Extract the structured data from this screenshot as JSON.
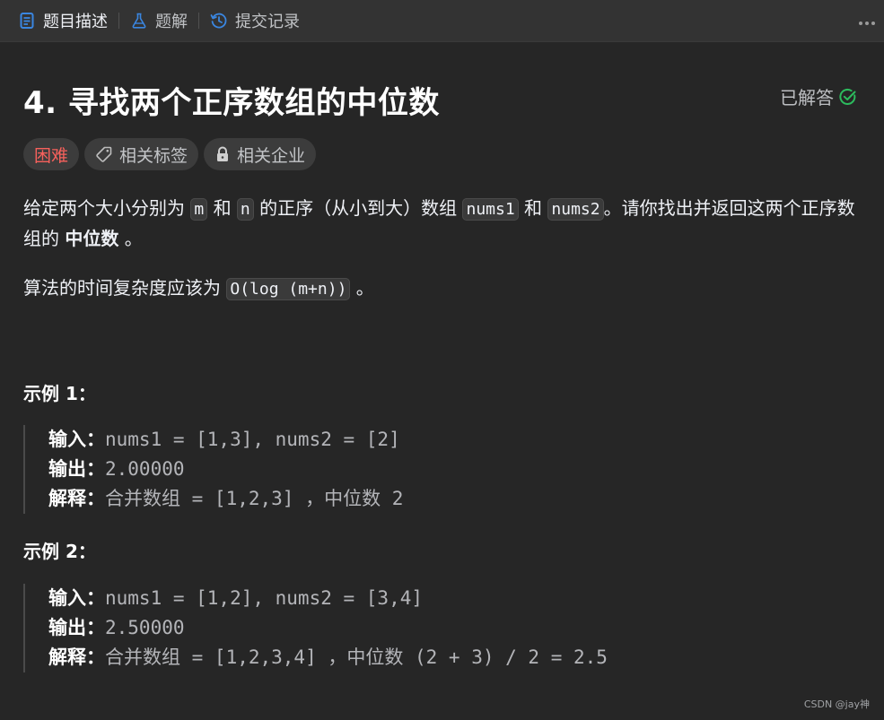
{
  "tabs": [
    {
      "label": "题目描述",
      "icon": "description-icon",
      "active": true
    },
    {
      "label": "题解",
      "icon": "flask-icon",
      "active": false
    },
    {
      "label": "提交记录",
      "icon": "history-icon",
      "active": false
    }
  ],
  "more_icon": "more-dots-icon",
  "problem": {
    "title": "4. 寻找两个正序数组的中位数",
    "status": "已解答",
    "tags": {
      "difficulty": "困难",
      "related_tags": "相关标签",
      "related_companies": "相关企业"
    },
    "description": {
      "p1_a": "给定两个大小分别为",
      "m": "m",
      "he1": "和",
      "n": "n",
      "p1_b": "的正序（从小到大）数组",
      "nums1": "nums1",
      "he2": "和",
      "nums2": "nums2",
      "p1_c": "。请你找出并返回这两个正序数组的",
      "median": "中位数",
      "p1_d": "。",
      "p2_a": "算法的时间复杂度应该为",
      "complexity": "O(log (m+n))",
      "p2_b": "。"
    },
    "examples": [
      {
        "title": "示例 1：",
        "input_label": "输入：",
        "input": "nums1 = [1,3], nums2 = [2]",
        "output_label": "输出：",
        "output": "2.00000",
        "explain_label": "解释：",
        "explain": "合并数组 = [1,2,3] ，中位数 2"
      },
      {
        "title": "示例 2：",
        "input_label": "输入：",
        "input": "nums1 = [1,2], nums2 = [3,4]",
        "output_label": "输出：",
        "output": "2.50000",
        "explain_label": "解释：",
        "explain": "合并数组 = [1,2,3,4] ，中位数 (2 + 3) / 2 = 2.5"
      }
    ]
  },
  "watermark": "CSDN @jay神",
  "colors": {
    "background": "#262626",
    "topbar": "#333333",
    "hard": "#f8615c",
    "solved_check": "#2cbb5d",
    "tab_icon_blue": "#3a86e0"
  }
}
